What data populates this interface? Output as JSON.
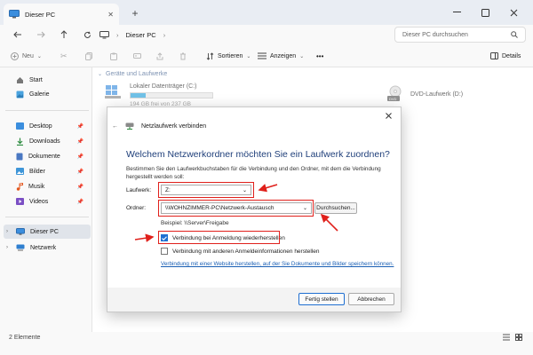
{
  "window": {
    "tab_title": "Dieser PC",
    "new_tab": "+",
    "controls": [
      "minimize",
      "maximize",
      "close"
    ]
  },
  "nav": {
    "breadcrumb": "Dieser PC",
    "search_placeholder": "Dieser PC durchsuchen"
  },
  "commandbar": {
    "new_label": "Neu",
    "sort_label": "Sortieren",
    "view_label": "Anzeigen",
    "more_label": "•••",
    "details_label": "Details"
  },
  "sidebar": {
    "items": [
      {
        "label": "Start",
        "icon": "home-icon"
      },
      {
        "label": "Galerie",
        "icon": "gallery-icon"
      },
      {
        "label": "Desktop",
        "icon": "desktop-folder-icon"
      },
      {
        "label": "Downloads",
        "icon": "download-icon"
      },
      {
        "label": "Dokumente",
        "icon": "document-icon"
      },
      {
        "label": "Bilder",
        "icon": "pictures-icon"
      },
      {
        "label": "Musik",
        "icon": "music-icon"
      },
      {
        "label": "Videos",
        "icon": "video-icon"
      },
      {
        "label": "Dieser PC",
        "icon": "pc-icon"
      },
      {
        "label": "Netzwerk",
        "icon": "network-icon"
      }
    ]
  },
  "main": {
    "group_header": "Geräte und Laufwerke",
    "drives": [
      {
        "name": "Lokaler Datenträger (C:)",
        "free": "194 GB frei von 237 GB",
        "used_fraction": 0.18
      },
      {
        "name": "DVD-Laufwerk (D:)",
        "badge": "DVD"
      }
    ]
  },
  "status": {
    "item_count": "2 Elemente"
  },
  "dialog": {
    "title": "Netzlaufwerk verbinden",
    "heading": "Welchem Netzwerkordner möchten Sie ein Laufwerk zuordnen?",
    "description": "Bestimmen Sie den Laufwerkbuchstaben für die Verbindung und den Ordner, mit dem die Verbindung hergestellt werden soll:",
    "drive_label": "Laufwerk:",
    "drive_value": "Z:",
    "folder_label": "Ordner:",
    "folder_value": "\\\\WOHNZIMMER-PC\\Netzwerk-Austausch",
    "browse_label": "Durchsuchen...",
    "example": "Beispiel: \\\\Server\\Freigabe",
    "reconnect_label": "Verbindung bei Anmeldung wiederherstellen",
    "reconnect_checked": true,
    "other_creds_label": "Verbindung mit anderen Anmeldeinformationen herstellen",
    "other_creds_checked": false,
    "link_text": "Verbindung mit einer Website herstellen, auf der Sie Dokumente und Bilder speichern können.",
    "finish_label": "Fertig stellen",
    "cancel_label": "Abbrechen"
  },
  "annotations": {
    "color": "#e0201b"
  }
}
